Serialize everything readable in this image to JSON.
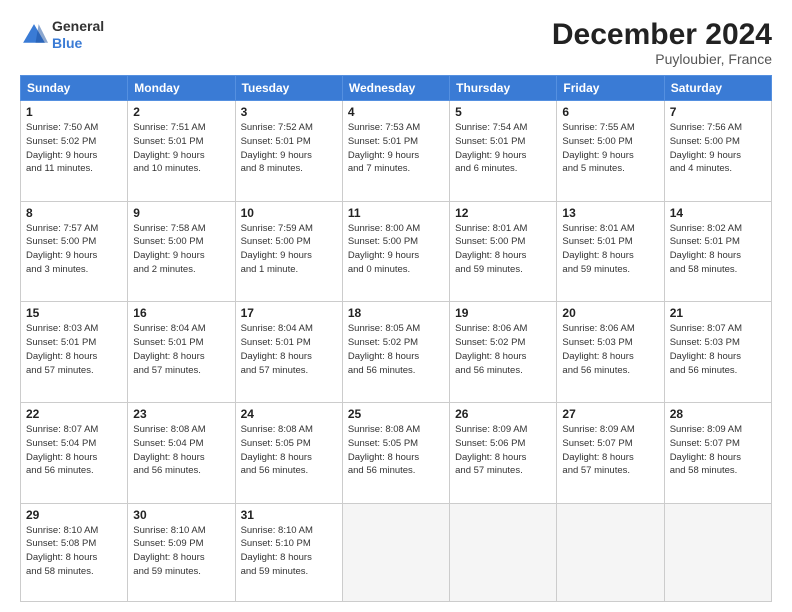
{
  "header": {
    "logo_general": "General",
    "logo_blue": "Blue",
    "month_title": "December 2024",
    "location": "Puyloubier, France"
  },
  "weekdays": [
    "Sunday",
    "Monday",
    "Tuesday",
    "Wednesday",
    "Thursday",
    "Friday",
    "Saturday"
  ],
  "weeks": [
    [
      {
        "day": 1,
        "info": "Sunrise: 7:50 AM\nSunset: 5:02 PM\nDaylight: 9 hours\nand 11 minutes."
      },
      {
        "day": 2,
        "info": "Sunrise: 7:51 AM\nSunset: 5:01 PM\nDaylight: 9 hours\nand 10 minutes."
      },
      {
        "day": 3,
        "info": "Sunrise: 7:52 AM\nSunset: 5:01 PM\nDaylight: 9 hours\nand 8 minutes."
      },
      {
        "day": 4,
        "info": "Sunrise: 7:53 AM\nSunset: 5:01 PM\nDaylight: 9 hours\nand 7 minutes."
      },
      {
        "day": 5,
        "info": "Sunrise: 7:54 AM\nSunset: 5:01 PM\nDaylight: 9 hours\nand 6 minutes."
      },
      {
        "day": 6,
        "info": "Sunrise: 7:55 AM\nSunset: 5:00 PM\nDaylight: 9 hours\nand 5 minutes."
      },
      {
        "day": 7,
        "info": "Sunrise: 7:56 AM\nSunset: 5:00 PM\nDaylight: 9 hours\nand 4 minutes."
      }
    ],
    [
      {
        "day": 8,
        "info": "Sunrise: 7:57 AM\nSunset: 5:00 PM\nDaylight: 9 hours\nand 3 minutes."
      },
      {
        "day": 9,
        "info": "Sunrise: 7:58 AM\nSunset: 5:00 PM\nDaylight: 9 hours\nand 2 minutes."
      },
      {
        "day": 10,
        "info": "Sunrise: 7:59 AM\nSunset: 5:00 PM\nDaylight: 9 hours\nand 1 minute."
      },
      {
        "day": 11,
        "info": "Sunrise: 8:00 AM\nSunset: 5:00 PM\nDaylight: 9 hours\nand 0 minutes."
      },
      {
        "day": 12,
        "info": "Sunrise: 8:01 AM\nSunset: 5:00 PM\nDaylight: 8 hours\nand 59 minutes."
      },
      {
        "day": 13,
        "info": "Sunrise: 8:01 AM\nSunset: 5:01 PM\nDaylight: 8 hours\nand 59 minutes."
      },
      {
        "day": 14,
        "info": "Sunrise: 8:02 AM\nSunset: 5:01 PM\nDaylight: 8 hours\nand 58 minutes."
      }
    ],
    [
      {
        "day": 15,
        "info": "Sunrise: 8:03 AM\nSunset: 5:01 PM\nDaylight: 8 hours\nand 57 minutes."
      },
      {
        "day": 16,
        "info": "Sunrise: 8:04 AM\nSunset: 5:01 PM\nDaylight: 8 hours\nand 57 minutes."
      },
      {
        "day": 17,
        "info": "Sunrise: 8:04 AM\nSunset: 5:01 PM\nDaylight: 8 hours\nand 57 minutes."
      },
      {
        "day": 18,
        "info": "Sunrise: 8:05 AM\nSunset: 5:02 PM\nDaylight: 8 hours\nand 56 minutes."
      },
      {
        "day": 19,
        "info": "Sunrise: 8:06 AM\nSunset: 5:02 PM\nDaylight: 8 hours\nand 56 minutes."
      },
      {
        "day": 20,
        "info": "Sunrise: 8:06 AM\nSunset: 5:03 PM\nDaylight: 8 hours\nand 56 minutes."
      },
      {
        "day": 21,
        "info": "Sunrise: 8:07 AM\nSunset: 5:03 PM\nDaylight: 8 hours\nand 56 minutes."
      }
    ],
    [
      {
        "day": 22,
        "info": "Sunrise: 8:07 AM\nSunset: 5:04 PM\nDaylight: 8 hours\nand 56 minutes."
      },
      {
        "day": 23,
        "info": "Sunrise: 8:08 AM\nSunset: 5:04 PM\nDaylight: 8 hours\nand 56 minutes."
      },
      {
        "day": 24,
        "info": "Sunrise: 8:08 AM\nSunset: 5:05 PM\nDaylight: 8 hours\nand 56 minutes."
      },
      {
        "day": 25,
        "info": "Sunrise: 8:08 AM\nSunset: 5:05 PM\nDaylight: 8 hours\nand 56 minutes."
      },
      {
        "day": 26,
        "info": "Sunrise: 8:09 AM\nSunset: 5:06 PM\nDaylight: 8 hours\nand 57 minutes."
      },
      {
        "day": 27,
        "info": "Sunrise: 8:09 AM\nSunset: 5:07 PM\nDaylight: 8 hours\nand 57 minutes."
      },
      {
        "day": 28,
        "info": "Sunrise: 8:09 AM\nSunset: 5:07 PM\nDaylight: 8 hours\nand 58 minutes."
      }
    ],
    [
      {
        "day": 29,
        "info": "Sunrise: 8:10 AM\nSunset: 5:08 PM\nDaylight: 8 hours\nand 58 minutes."
      },
      {
        "day": 30,
        "info": "Sunrise: 8:10 AM\nSunset: 5:09 PM\nDaylight: 8 hours\nand 59 minutes."
      },
      {
        "day": 31,
        "info": "Sunrise: 8:10 AM\nSunset: 5:10 PM\nDaylight: 8 hours\nand 59 minutes."
      },
      {
        "day": null,
        "info": ""
      },
      {
        "day": null,
        "info": ""
      },
      {
        "day": null,
        "info": ""
      },
      {
        "day": null,
        "info": ""
      }
    ]
  ]
}
